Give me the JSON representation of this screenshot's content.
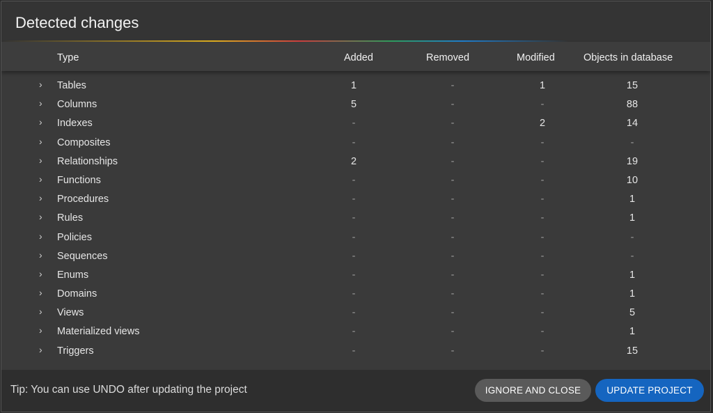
{
  "dialog": {
    "title": "Detected changes",
    "columns": {
      "type": "Type",
      "added": "Added",
      "removed": "Removed",
      "modified": "Modified",
      "objects": "Objects in database"
    },
    "rows": [
      {
        "type": "Tables",
        "added": "1",
        "removed": "-",
        "modified": "1",
        "objects": "15"
      },
      {
        "type": "Columns",
        "added": "5",
        "removed": "-",
        "modified": "-",
        "objects": "88"
      },
      {
        "type": "Indexes",
        "added": "-",
        "removed": "-",
        "modified": "2",
        "objects": "14"
      },
      {
        "type": "Composites",
        "added": "-",
        "removed": "-",
        "modified": "-",
        "objects": "-"
      },
      {
        "type": "Relationships",
        "added": "2",
        "removed": "-",
        "modified": "-",
        "objects": "19"
      },
      {
        "type": "Functions",
        "added": "-",
        "removed": "-",
        "modified": "-",
        "objects": "10"
      },
      {
        "type": "Procedures",
        "added": "-",
        "removed": "-",
        "modified": "-",
        "objects": "1"
      },
      {
        "type": "Rules",
        "added": "-",
        "removed": "-",
        "modified": "-",
        "objects": "1"
      },
      {
        "type": "Policies",
        "added": "-",
        "removed": "-",
        "modified": "-",
        "objects": "-"
      },
      {
        "type": "Sequences",
        "added": "-",
        "removed": "-",
        "modified": "-",
        "objects": "-"
      },
      {
        "type": "Enums",
        "added": "-",
        "removed": "-",
        "modified": "-",
        "objects": "1"
      },
      {
        "type": "Domains",
        "added": "-",
        "removed": "-",
        "modified": "-",
        "objects": "1"
      },
      {
        "type": "Views",
        "added": "-",
        "removed": "-",
        "modified": "-",
        "objects": "5"
      },
      {
        "type": "Materialized views",
        "added": "-",
        "removed": "-",
        "modified": "-",
        "objects": "1"
      },
      {
        "type": "Triggers",
        "added": "-",
        "removed": "-",
        "modified": "-",
        "objects": "15"
      }
    ],
    "footer": {
      "tip": "Tip: You can use UNDO after updating the project",
      "ignore_label": "IGNORE AND CLOSE",
      "update_label": "UPDATE PROJECT"
    }
  },
  "colors": {
    "background": "#3a3a3a",
    "header": "#3d3d3d",
    "footer": "#2e2e2e",
    "ignore_button": "#5a5a5a",
    "update_button": "#1565c0"
  },
  "icons": {
    "row_expand": "chevron-right-icon"
  }
}
